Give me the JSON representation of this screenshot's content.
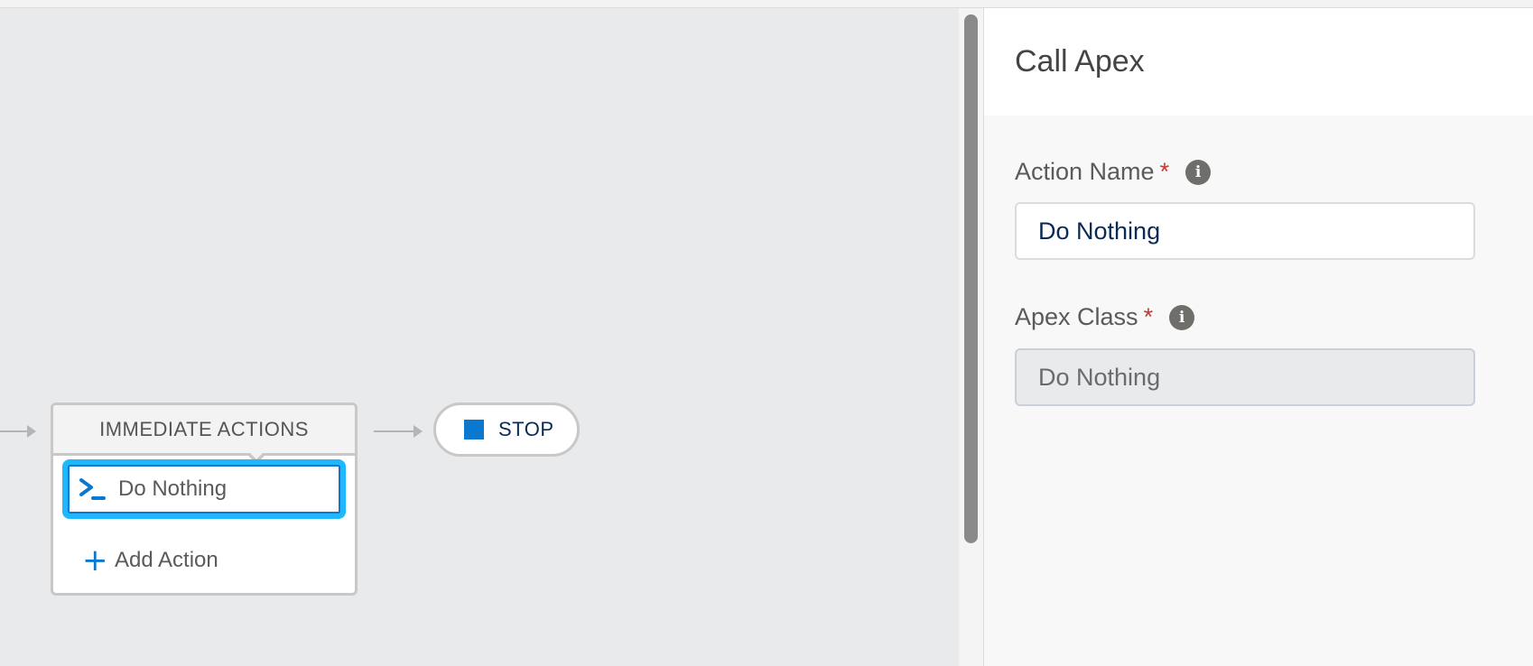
{
  "flow": {
    "immediate_actions_header": "IMMEDIATE ACTIONS",
    "action_item_label": "Do Nothing",
    "add_action_label": "Add Action",
    "stop_label": "STOP",
    "accent_color": "#1fb8ff",
    "icon_color": "#0b78d0"
  },
  "panel": {
    "title": "Call Apex",
    "fields": [
      {
        "label": "Action Name",
        "required_mark": "*",
        "info_icon": "info-icon",
        "value": "Do Nothing"
      },
      {
        "label": "Apex Class",
        "required_mark": "*",
        "info_icon": "info-icon",
        "value": "Do Nothing"
      }
    ]
  }
}
